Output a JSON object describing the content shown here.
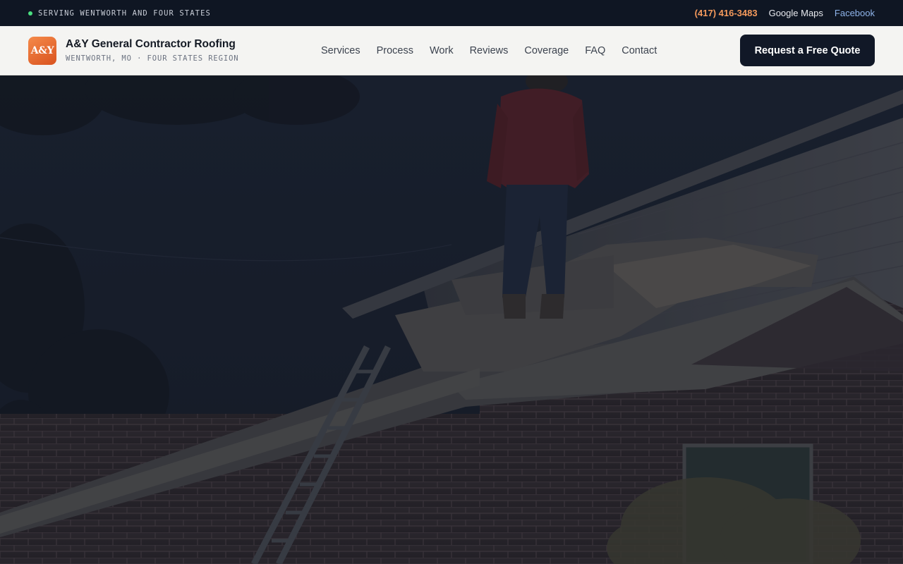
{
  "topbar": {
    "serving_text": "SERVING WENTWORTH AND FOUR STATES",
    "phone": "(417) 416-3483",
    "maps_label": "Google Maps",
    "facebook_label": "Facebook"
  },
  "header": {
    "logo_text": "A&Y",
    "brand_name": "A&Y General Contractor Roofing",
    "brand_sub": "WENTWORTH, MO · FOUR STATES REGION",
    "nav": [
      "Services",
      "Process",
      "Work",
      "Reviews",
      "Coverage",
      "FAQ",
      "Contact"
    ],
    "cta_label": "Request a Free Quote"
  },
  "colors": {
    "accent": "#f59a5c",
    "brand_orange": "#e4622b",
    "dark": "#111827",
    "status_dot": "#4ade80"
  }
}
